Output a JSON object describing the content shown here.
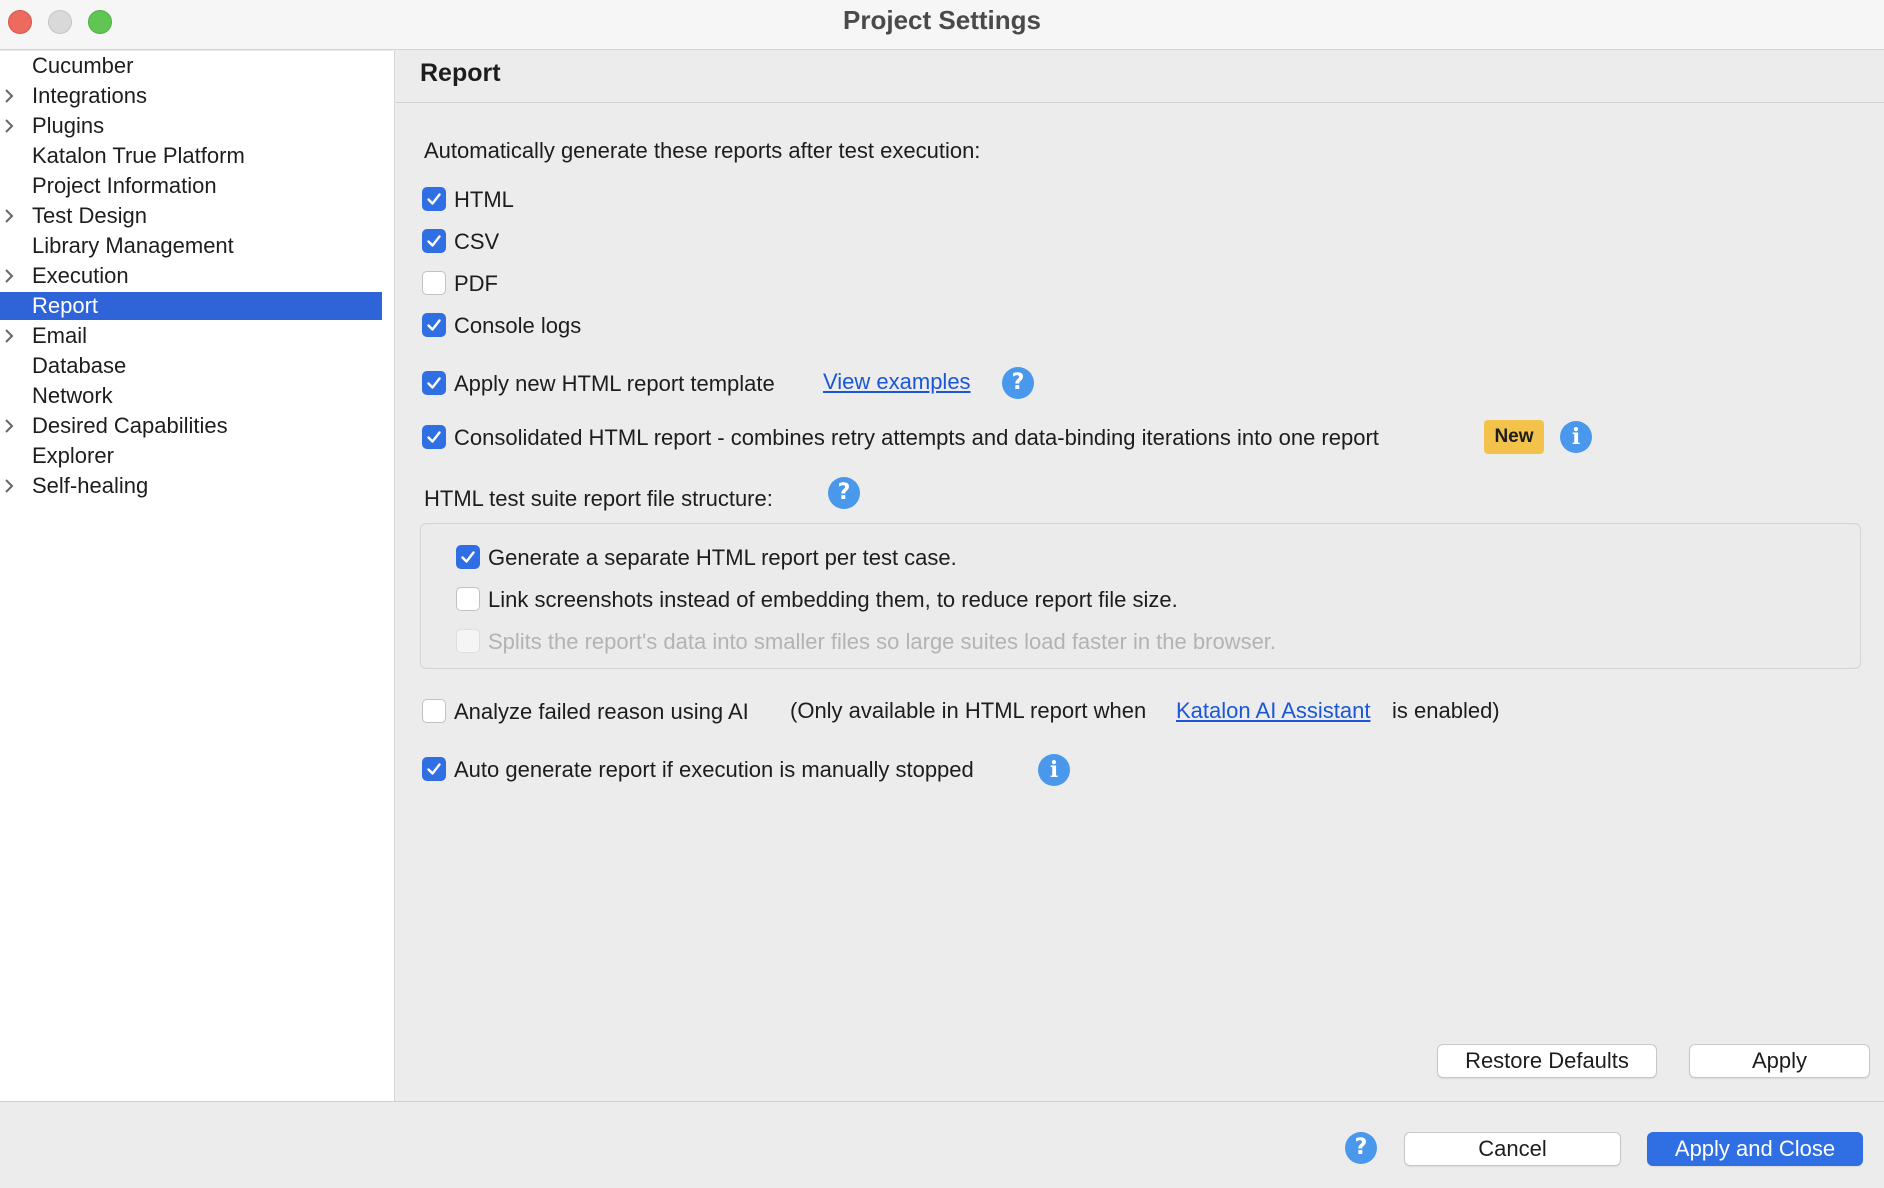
{
  "window": {
    "title": "Project Settings"
  },
  "sidebar": {
    "items": [
      {
        "label": "Cucumber",
        "expandable": false,
        "selected": false
      },
      {
        "label": "Integrations",
        "expandable": true,
        "selected": false
      },
      {
        "label": "Plugins",
        "expandable": true,
        "selected": false
      },
      {
        "label": "Katalon True Platform",
        "expandable": false,
        "selected": false
      },
      {
        "label": "Project Information",
        "expandable": false,
        "selected": false
      },
      {
        "label": "Test Design",
        "expandable": true,
        "selected": false
      },
      {
        "label": "Library Management",
        "expandable": false,
        "selected": false
      },
      {
        "label": "Execution",
        "expandable": true,
        "selected": false
      },
      {
        "label": "Report",
        "expandable": false,
        "selected": true
      },
      {
        "label": "Email",
        "expandable": true,
        "selected": false
      },
      {
        "label": "Database",
        "expandable": false,
        "selected": false
      },
      {
        "label": "Network",
        "expandable": false,
        "selected": false
      },
      {
        "label": "Desired Capabilities",
        "expandable": true,
        "selected": false
      },
      {
        "label": "Explorer",
        "expandable": false,
        "selected": false
      },
      {
        "label": "Self-healing",
        "expandable": true,
        "selected": false
      }
    ]
  },
  "main": {
    "title": "Report",
    "auto_generate_label": "Automatically generate these reports after test execution:",
    "formats": [
      {
        "label": "HTML",
        "checked": true
      },
      {
        "label": "CSV",
        "checked": true
      },
      {
        "label": "PDF",
        "checked": false
      },
      {
        "label": "Console logs",
        "checked": true
      }
    ],
    "new_template": {
      "label": "Apply new HTML report template",
      "checked": true,
      "link": "View examples"
    },
    "consolidated": {
      "label": "Consolidated HTML report - combines retry attempts and data-binding iterations into one report",
      "checked": true,
      "badge": "New"
    },
    "structure_label": "HTML test suite report file structure:",
    "structure_options": [
      {
        "label": "Generate a separate HTML report per test case.",
        "checked": true,
        "disabled": false
      },
      {
        "label": "Link screenshots instead of embedding them, to reduce report file size.",
        "checked": false,
        "disabled": false
      },
      {
        "label": "Splits the report's data into smaller files so large suites load faster in the browser.",
        "checked": false,
        "disabled": true
      }
    ],
    "ai_analysis": {
      "label": "Analyze failed reason using AI",
      "checked": false,
      "note_prefix": "(Only available in HTML report when",
      "note_link": "Katalon AI Assistant",
      "note_suffix": "is enabled)"
    },
    "auto_stop": {
      "label": "Auto generate report if execution is manually stopped",
      "checked": true
    },
    "buttons": {
      "restore_defaults": "Restore Defaults",
      "apply": "Apply"
    }
  },
  "footer": {
    "cancel": "Cancel",
    "apply_and_close": "Apply and Close"
  },
  "icons": {
    "help_glyph": "?",
    "info_glyph": "i"
  },
  "colors": {
    "accent": "#2f6fe3",
    "selection": "#2f64d9",
    "link": "#1a57d6",
    "badge": "#f2c24a",
    "icon_blue": "#4a98ec"
  }
}
